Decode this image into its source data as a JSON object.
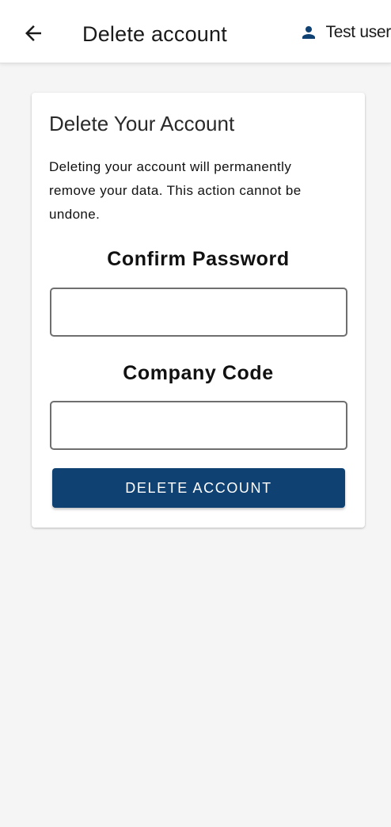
{
  "header": {
    "back_icon": "arrow-left-icon",
    "title": "Delete account",
    "user_icon": "person-icon",
    "user_name": "Test user"
  },
  "card": {
    "title": "Delete Your Account",
    "description": "Deleting your account will permanently remove your data. This action cannot be undone.",
    "password_label": "Confirm Password",
    "password_value": "",
    "company_code_label": "Company Code",
    "company_code_value": "",
    "delete_button_label": "DELETE ACCOUNT"
  },
  "colors": {
    "primary": "#0f4273",
    "user_icon": "#0f4273",
    "background": "#f5f5f5",
    "surface": "#ffffff"
  }
}
